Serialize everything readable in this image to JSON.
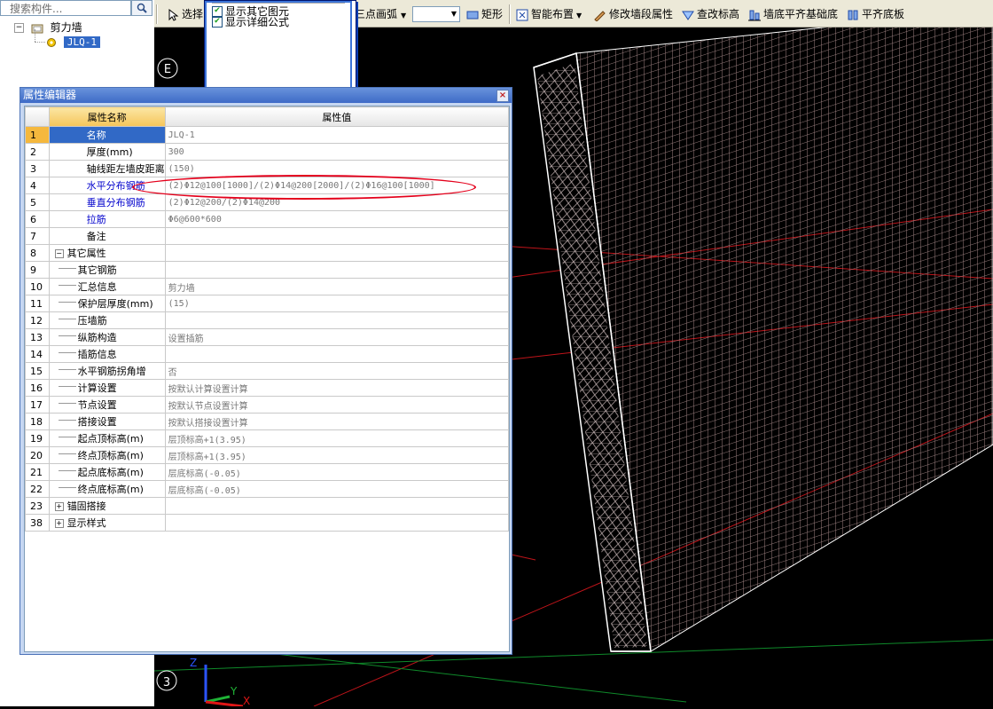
{
  "tree": {
    "search_placeholder": "搜索构件...",
    "search_icon": "magnifier-icon",
    "root_expander": "−",
    "root_label": "剪力墙",
    "child_label": "JLQ-1"
  },
  "toolbar": {
    "select_label": "选择",
    "arc_label": "三点画弧",
    "rect_label": "矩形",
    "smart_label": "智能布置",
    "modify_label": "修改墙段属性",
    "check_label": "查改标高",
    "align_base_label": "墙底平齐基础底",
    "align_bottom_label": "平齐底板"
  },
  "popup": {
    "items": [
      {
        "label": "显示其它图元",
        "checked": true
      },
      {
        "label": "显示详细公式",
        "checked": true
      }
    ]
  },
  "viewport": {
    "axis_label_e": "E",
    "axis_label_3": "3",
    "axis_z": "Z",
    "axis_y": "Y",
    "axis_x": "X"
  },
  "prop_editor": {
    "title": "属性编辑器",
    "close": "×",
    "col_name": "属性名称",
    "col_value": "属性值",
    "rows": [
      {
        "num": "1",
        "name": "名称",
        "value": "JLQ-1",
        "blue": false,
        "level": 0
      },
      {
        "num": "2",
        "name": "厚度(mm)",
        "value": "300",
        "blue": false,
        "level": 0
      },
      {
        "num": "3",
        "name": "轴线距左墙皮距离",
        "value": "(150)",
        "blue": false,
        "level": 0
      },
      {
        "num": "4",
        "name": "水平分布钢筋",
        "value": "(2)Φ12@100[1000]/(2)Φ14@200[2000]/(2)Φ16@100[1000]",
        "blue": true,
        "level": 0
      },
      {
        "num": "5",
        "name": "垂直分布钢筋",
        "value": "(2)Φ12@200/(2)Φ14@200",
        "blue": true,
        "level": 0
      },
      {
        "num": "6",
        "name": "拉筋",
        "value": "Φ6@600*600",
        "blue": true,
        "level": 0
      },
      {
        "num": "7",
        "name": "备注",
        "value": "",
        "blue": false,
        "level": 0
      },
      {
        "num": "8",
        "name": "其它属性",
        "value": "",
        "blue": false,
        "level": 0,
        "group": "−"
      },
      {
        "num": "9",
        "name": "其它钢筋",
        "value": "",
        "blue": false,
        "level": 1
      },
      {
        "num": "10",
        "name": "汇总信息",
        "value": "剪力墙",
        "blue": false,
        "level": 1
      },
      {
        "num": "11",
        "name": "保护层厚度(mm)",
        "value": "(15)",
        "blue": false,
        "level": 1
      },
      {
        "num": "12",
        "name": "压墙筋",
        "value": "",
        "blue": false,
        "level": 1
      },
      {
        "num": "13",
        "name": "纵筋构造",
        "value": "设置插筋",
        "blue": false,
        "level": 1
      },
      {
        "num": "14",
        "name": "插筋信息",
        "value": "",
        "blue": false,
        "level": 1
      },
      {
        "num": "15",
        "name": "水平钢筋拐角增",
        "value": "否",
        "blue": false,
        "level": 1
      },
      {
        "num": "16",
        "name": "计算设置",
        "value": "按默认计算设置计算",
        "blue": false,
        "level": 1
      },
      {
        "num": "17",
        "name": "节点设置",
        "value": "按默认节点设置计算",
        "blue": false,
        "level": 1
      },
      {
        "num": "18",
        "name": "搭接设置",
        "value": "按默认搭接设置计算",
        "blue": false,
        "level": 1
      },
      {
        "num": "19",
        "name": "起点顶标高(m)",
        "value": "层顶标高+1(3.95)",
        "blue": false,
        "level": 1
      },
      {
        "num": "20",
        "name": "终点顶标高(m)",
        "value": "层顶标高+1(3.95)",
        "blue": false,
        "level": 1
      },
      {
        "num": "21",
        "name": "起点底标高(m)",
        "value": "层底标高(-0.05)",
        "blue": false,
        "level": 1
      },
      {
        "num": "22",
        "name": "终点底标高(m)",
        "value": "层底标高(-0.05)",
        "blue": false,
        "level": 1
      },
      {
        "num": "23",
        "name": "锚固搭接",
        "value": "",
        "blue": false,
        "level": 0,
        "group": "+"
      },
      {
        "num": "38",
        "name": "显示样式",
        "value": "",
        "blue": false,
        "level": 0,
        "group": "+"
      }
    ]
  },
  "colors": {
    "highlight": "#e4001b",
    "selection": "#3169c6",
    "title_bar": "#3e6bc7"
  }
}
